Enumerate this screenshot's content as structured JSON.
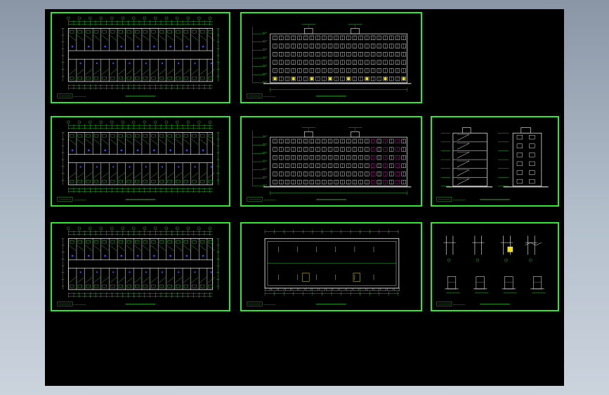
{
  "sheets": [
    {
      "id": "floor-plan-1",
      "kind": "plan",
      "title": "",
      "note": ""
    },
    {
      "id": "elevation-front",
      "kind": "elevation",
      "title": "",
      "note": ""
    },
    {
      "id": "floor-plan-2",
      "kind": "plan",
      "title": "",
      "note": ""
    },
    {
      "id": "elevation-rear",
      "kind": "elevation2",
      "title": "",
      "note": ""
    },
    {
      "id": "side-elevations",
      "kind": "side",
      "title": "",
      "note": ""
    },
    {
      "id": "floor-plan-3",
      "kind": "plan",
      "title": "",
      "note": ""
    },
    {
      "id": "roof-plan",
      "kind": "roof",
      "title": "",
      "note": ""
    },
    {
      "id": "details",
      "kind": "details",
      "title": "",
      "note": ""
    }
  ],
  "colors": {
    "frame": "#2ee82e",
    "canvas": "#000000",
    "window": "#ffffff",
    "accent_yellow": "#f0e020",
    "accent_blue": "#3050ff",
    "accent_magenta": "#e020c0",
    "accent_red": "#ff3030"
  }
}
